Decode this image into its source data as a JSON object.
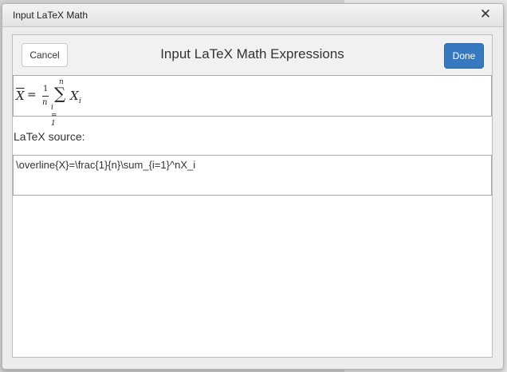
{
  "window": {
    "title": "Input LaTeX Math",
    "close_label": "✕"
  },
  "dialog": {
    "title": "Input LaTeX Math Expressions",
    "cancel_label": "Cancel",
    "done_label": "Done"
  },
  "preview": {
    "lhs": "X",
    "equals": "=",
    "frac_numerator": "1",
    "frac_denominator": "n",
    "sum_upper": "n",
    "sum_symbol": "∑",
    "sum_lower": "i = 1",
    "term": "X",
    "term_subscript": "i"
  },
  "source": {
    "label": "LaTeX source:",
    "value": "\\overline{X}=\\frac{1}{n}\\sum_{i=1}^nX_i"
  },
  "colors": {
    "accent": "#3779bf"
  }
}
